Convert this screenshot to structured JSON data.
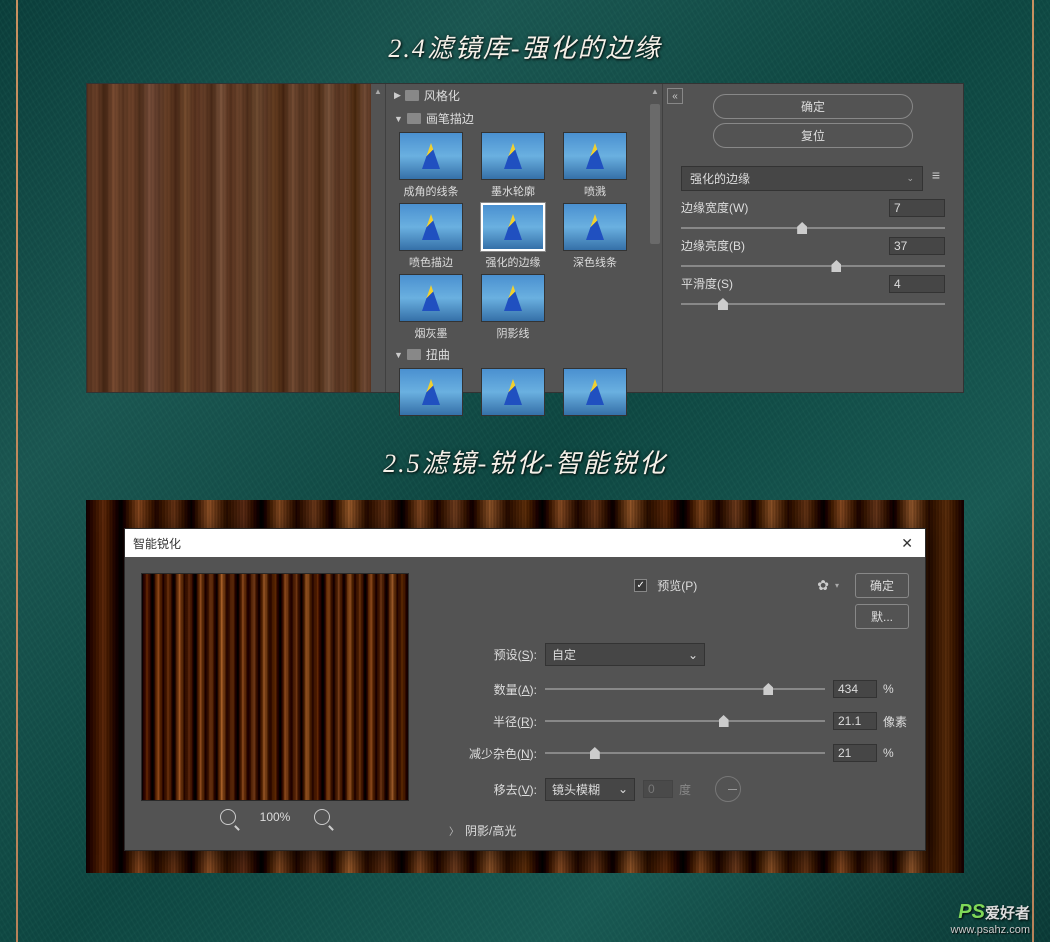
{
  "headings": {
    "h1": "2.4滤镜库-强化的边缘",
    "h2": "2.5滤镜-锐化-智能锐化"
  },
  "filterGallery": {
    "folders": {
      "f1": "风格化",
      "f2": "画笔描边",
      "f3": "扭曲"
    },
    "thumbs": {
      "t1": "成角的线条",
      "t2": "墨水轮廓",
      "t3": "喷溅",
      "t4": "喷色描边",
      "t5": "强化的边缘",
      "t6": "深色线条",
      "t7": "烟灰墨",
      "t8": "阴影线"
    },
    "buttons": {
      "ok": "确定",
      "reset": "复位"
    },
    "dropdown": "强化的边缘",
    "sliders": {
      "s1": {
        "label": "边缘宽度(W)",
        "value": "7"
      },
      "s2": {
        "label": "边缘亮度(B)",
        "value": "37"
      },
      "s3": {
        "label": "平滑度(S)",
        "value": "4"
      }
    }
  },
  "smartSharpen": {
    "title": "智能锐化",
    "previewChk": "预览(P)",
    "ok": "确定",
    "default": "默...",
    "zoom": "100%",
    "rows": {
      "preset": {
        "label": "预设(S):",
        "value": "自定"
      },
      "amount": {
        "label": "数量(A):",
        "value": "434",
        "unit": "%"
      },
      "radius": {
        "label": "半径(R):",
        "value": "21.1",
        "unit": "像素"
      },
      "noise": {
        "label": "减少杂色(N):",
        "value": "21",
        "unit": "%"
      },
      "remove": {
        "label": "移去(V):",
        "value": "镜头模糊",
        "angle": "0",
        "angleUnit": "度"
      }
    },
    "expand": "阴影/高光"
  },
  "watermark": {
    "line1a": "PS",
    "line1b": "爱好者",
    "line2": "www.psahz.com"
  }
}
